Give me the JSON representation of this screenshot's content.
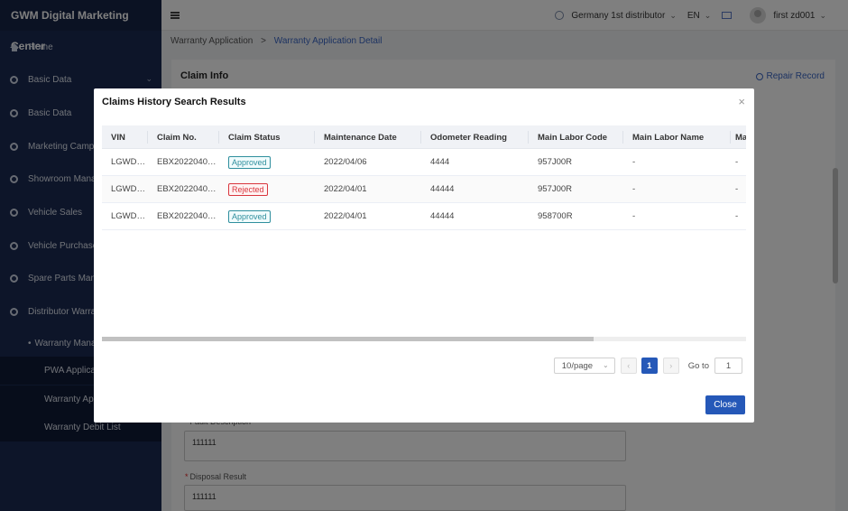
{
  "sidebar": {
    "brand": "GWM Digital Marketing Center",
    "items": [
      {
        "label": "Home",
        "icon": "home-icon"
      },
      {
        "label": "Basic Data",
        "icon": "circle-icon",
        "chevron": true
      },
      {
        "label": "Basic Data",
        "icon": "circle-icon"
      },
      {
        "label": "Marketing Campa",
        "icon": "circle-icon"
      },
      {
        "label": "Showroom Manag",
        "icon": "circle-icon"
      },
      {
        "label": "Vehicle Sales",
        "icon": "circle-icon"
      },
      {
        "label": "Vehicle Purchase",
        "icon": "circle-icon"
      },
      {
        "label": "Spare Parts Mana",
        "icon": "circle-icon"
      },
      {
        "label": "Distributor Warran",
        "icon": "circle-icon"
      }
    ],
    "sub_group": "Warranty Manag",
    "sub_items": [
      "PWA Applicat",
      "Warranty App",
      "Warranty Debit List"
    ]
  },
  "topbar": {
    "distributor": "Germany 1st distributor",
    "language": "EN",
    "user": "first zd001"
  },
  "breadcrumb": {
    "parent": "Warranty Application",
    "separator": ">",
    "current": "Warranty Application Detail"
  },
  "card": {
    "title": "Claim Info",
    "repair_link": "Repair Record",
    "fault_label": "Fault Description",
    "fault_value": "111111",
    "disposal_label": "Disposal Result",
    "disposal_value": "111111"
  },
  "modal": {
    "title": "Claims History Search Results",
    "close_x": "×",
    "columns": [
      "VIN",
      "Claim No.",
      "Claim Status",
      "Maintenance Date",
      "Odometer Reading",
      "Main Labor Code",
      "Main Labor Name",
      "Ma"
    ],
    "rows": [
      {
        "vin": "LGWD…",
        "claim_no": "EBX2022040…",
        "status": "Approved",
        "date": "2022/04/06",
        "odometer": "4444",
        "labor_code": "957J00R",
        "labor_name": "-",
        "extra": "-"
      },
      {
        "vin": "LGWD…",
        "claim_no": "EBX2022040…",
        "status": "Rejected",
        "date": "2022/04/01",
        "odometer": "44444",
        "labor_code": "957J00R",
        "labor_name": "-",
        "extra": "-"
      },
      {
        "vin": "LGWD…",
        "claim_no": "EBX2022040…",
        "status": "Approved",
        "date": "2022/04/01",
        "odometer": "44444",
        "labor_code": "958700R",
        "labor_name": "-",
        "extra": "-"
      }
    ],
    "pagination": {
      "page_size": "10/page",
      "prev": "‹",
      "current_page": "1",
      "next": "›",
      "goto_label": "Go to",
      "goto_value": "1"
    },
    "close_button": "Close"
  },
  "colors": {
    "sidebar_bg": "#1a2a52",
    "primary": "#2558b8",
    "approved": "#2f8f9e",
    "rejected": "#d9363e"
  }
}
